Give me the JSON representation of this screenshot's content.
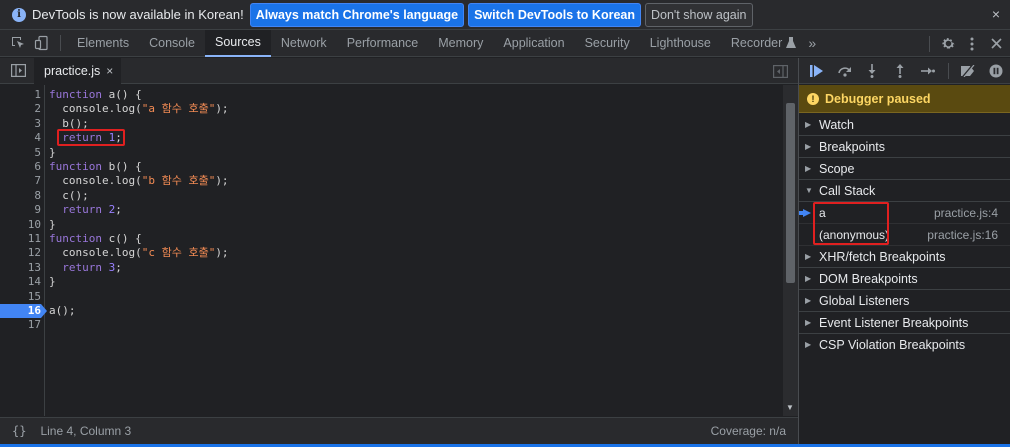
{
  "infobar": {
    "message": "DevTools is now available in Korean!",
    "btn_match": "Always match Chrome's language",
    "btn_switch": "Switch DevTools to Korean",
    "btn_dismiss": "Don't show again",
    "close": "×"
  },
  "toolbar": {
    "tabs": [
      "Elements",
      "Console",
      "Sources",
      "Network",
      "Performance",
      "Memory",
      "Application",
      "Security",
      "Lighthouse",
      "Recorder"
    ],
    "active_tab": "Sources",
    "more": "»"
  },
  "editor": {
    "file_tab": "practice.js",
    "file_tab_close": "×",
    "lines": [
      {
        "n": "1",
        "code": "function a() {"
      },
      {
        "n": "2",
        "code": "  console.log(\"a 함수 호출\");"
      },
      {
        "n": "3",
        "code": "  b();"
      },
      {
        "n": "4",
        "code": "  return 1;"
      },
      {
        "n": "5",
        "code": "}"
      },
      {
        "n": "6",
        "code": "function b() {"
      },
      {
        "n": "7",
        "code": "  console.log(\"b 함수 호출\");"
      },
      {
        "n": "8",
        "code": "  c();"
      },
      {
        "n": "9",
        "code": "  return 2;"
      },
      {
        "n": "10",
        "code": "}"
      },
      {
        "n": "11",
        "code": "function c() {"
      },
      {
        "n": "12",
        "code": "  console.log(\"c 함수 호출\");"
      },
      {
        "n": "13",
        "code": "  return 3;"
      },
      {
        "n": "14",
        "code": "}"
      },
      {
        "n": "15",
        "code": ""
      },
      {
        "n": "16",
        "code": "a();"
      },
      {
        "n": "17",
        "code": ""
      }
    ],
    "execution_line": 4,
    "breakpoint_line": 16
  },
  "status": {
    "braces": "{}",
    "position": "Line 4, Column 3",
    "coverage": "Coverage: n/a"
  },
  "debugger": {
    "paused": "Debugger paused",
    "sections": {
      "watch": "Watch",
      "breakpoints": "Breakpoints",
      "scope": "Scope",
      "call_stack": "Call Stack",
      "xhr": "XHR/fetch Breakpoints",
      "dom": "DOM Breakpoints",
      "global": "Global Listeners",
      "event": "Event Listener Breakpoints",
      "csp": "CSP Violation Breakpoints"
    },
    "call_stack": [
      {
        "name": "a",
        "location": "practice.js:4"
      },
      {
        "name": "(anonymous)",
        "location": "practice.js:16"
      }
    ]
  },
  "colors": {
    "accent": "#1a73e8",
    "paused_banner": "#5a4a10",
    "exec_line": "#2a5e33",
    "annotation": "#e02020"
  }
}
